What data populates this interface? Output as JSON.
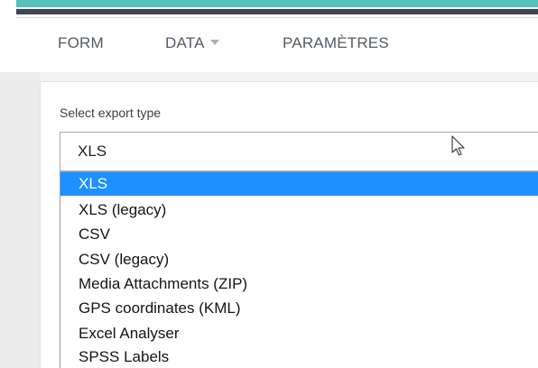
{
  "nav": {
    "tabs": [
      {
        "label": "FORM"
      },
      {
        "label": "DATA"
      },
      {
        "label": "PARAMÈTRES"
      }
    ]
  },
  "export": {
    "label": "Select export type",
    "selected_value": "XLS",
    "options": [
      {
        "label": "XLS",
        "selected": true
      },
      {
        "label": "XLS (legacy)",
        "selected": false
      },
      {
        "label": "CSV",
        "selected": false
      },
      {
        "label": "CSV (legacy)",
        "selected": false
      },
      {
        "label": "Media Attachments (ZIP)",
        "selected": false
      },
      {
        "label": "GPS coordinates (KML)",
        "selected": false
      },
      {
        "label": "Excel Analyser",
        "selected": false
      },
      {
        "label": "SPSS Labels",
        "selected": false
      }
    ]
  },
  "colors": {
    "accent": "#56c2bd",
    "header_dark": "#3a4556",
    "selection": "#1e90ff"
  },
  "icons": {
    "caret": "chevron-down-icon",
    "cursor": "mouse-pointer-icon"
  }
}
